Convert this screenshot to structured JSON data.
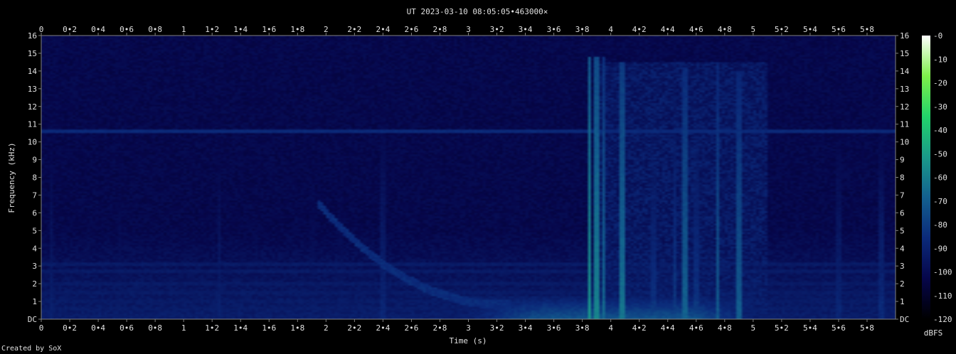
{
  "chart_data": {
    "type": "heatmap",
    "title": "UT 2023-03-10 08:05:05•463000×",
    "xlabel": "Time (s)",
    "ylabel": "Frequency (kHz)",
    "xlim": [
      0,
      6.0
    ],
    "ylim": [
      0,
      16
    ],
    "x_ticks": [
      "0",
      "0•2",
      "0•4",
      "0•6",
      "0•8",
      "1",
      "1•2",
      "1•4",
      "1•6",
      "1•8",
      "2",
      "2•2",
      "2•4",
      "2•6",
      "2•8",
      "3",
      "3•2",
      "3•4",
      "3•6",
      "3•8",
      "4",
      "4•2",
      "4•4",
      "4•6",
      "4•8",
      "5",
      "5•2",
      "5•4",
      "5•6",
      "5•8"
    ],
    "x_tick_values": [
      0,
      0.2,
      0.4,
      0.6,
      0.8,
      1.0,
      1.2,
      1.4,
      1.6,
      1.8,
      2.0,
      2.2,
      2.4,
      2.6,
      2.8,
      3.0,
      3.2,
      3.4,
      3.6,
      3.8,
      4.0,
      4.2,
      4.4,
      4.6,
      4.8,
      5.0,
      5.2,
      5.4,
      5.6,
      5.8
    ],
    "y_ticks": [
      "DC",
      "1",
      "2",
      "3",
      "4",
      "5",
      "6",
      "7",
      "8",
      "9",
      "10",
      "11",
      "12",
      "13",
      "14",
      "15",
      "16"
    ],
    "y_tick_values": [
      0,
      1,
      2,
      3,
      4,
      5,
      6,
      7,
      8,
      9,
      10,
      11,
      12,
      13,
      14,
      15,
      16
    ],
    "colorbar": {
      "label": "dBFS",
      "ticks": [
        "-0",
        "-10",
        "-20",
        "-30",
        "-40",
        "-50",
        "-60",
        "-70",
        "-80",
        "-90",
        "-100",
        "-110",
        "-120"
      ],
      "tick_values": [
        0,
        -10,
        -20,
        -30,
        -40,
        -50,
        -60,
        -70,
        -80,
        -90,
        -100,
        -110,
        -120
      ],
      "range": [
        -120,
        0
      ],
      "colors": [
        "#000000",
        "#06064a",
        "#0b2a7a",
        "#13608f",
        "#1a9a8a",
        "#22d36a",
        "#7ef04a",
        "#ffffff"
      ]
    },
    "features": {
      "background_dbfs": -105,
      "tone_band": {
        "freq_khz": 10.6,
        "dbfs": -88
      },
      "low_freq_hum_khz": [
        0.2,
        0.6,
        1.0,
        1.5,
        2.0,
        2.7,
        3.1
      ],
      "whistler": {
        "t_start": 1.95,
        "t_end": 3.3,
        "f_start_khz": 6.5,
        "f_end_khz": 0.8
      },
      "spherics": [
        {
          "t": 0.07,
          "f_max": 13.5,
          "dbfs": -92
        },
        {
          "t": 0.55,
          "f_max": 12.8,
          "dbfs": -95
        },
        {
          "t": 1.25,
          "f_max": 13.5,
          "dbfs": -92
        },
        {
          "t": 1.9,
          "f_max": 13.5,
          "dbfs": -96
        },
        {
          "t": 2.1,
          "f_max": 12.0,
          "dbfs": -96
        },
        {
          "t": 2.4,
          "f_max": 14.0,
          "dbfs": -90
        },
        {
          "t": 3.85,
          "f_max": 14.8,
          "dbfs": -55
        },
        {
          "t": 3.9,
          "f_max": 14.8,
          "dbfs": -60
        },
        {
          "t": 3.95,
          "f_max": 14.8,
          "dbfs": -68
        },
        {
          "t": 4.08,
          "f_max": 14.5,
          "dbfs": -65
        },
        {
          "t": 4.3,
          "f_max": 13.0,
          "dbfs": -85
        },
        {
          "t": 4.45,
          "f_max": 13.5,
          "dbfs": -82
        },
        {
          "t": 4.52,
          "f_max": 14.2,
          "dbfs": -70
        },
        {
          "t": 4.6,
          "f_max": 13.0,
          "dbfs": -84
        },
        {
          "t": 4.75,
          "f_max": 14.5,
          "dbfs": -72
        },
        {
          "t": 4.9,
          "f_max": 14.0,
          "dbfs": -72
        },
        {
          "t": 5.6,
          "f_max": 12.5,
          "dbfs": -90
        },
        {
          "t": 5.9,
          "f_max": 12.0,
          "dbfs": -88
        }
      ]
    }
  },
  "credit": "Created by SoX"
}
